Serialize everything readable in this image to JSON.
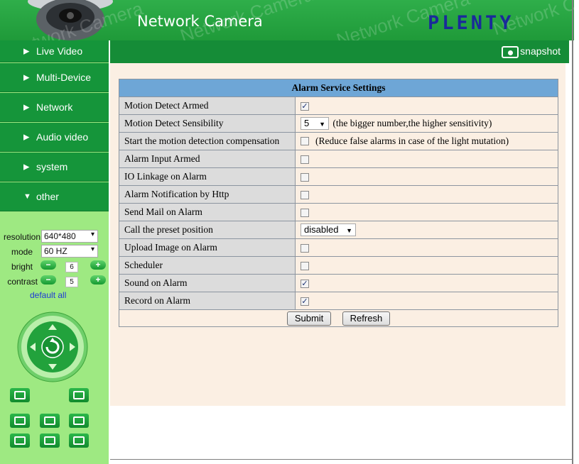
{
  "header": {
    "title": "Network Camera",
    "brand": "PLENTY",
    "watermark": "Network Camera"
  },
  "nav": [
    {
      "label": "Live Video",
      "icon": "play-arrow-icon"
    },
    {
      "label": "Multi-Device",
      "icon": "play-arrow-icon"
    },
    {
      "label": "Network",
      "icon": "play-arrow-icon"
    },
    {
      "label": "Audio video",
      "icon": "play-arrow-icon"
    },
    {
      "label": "system",
      "icon": "play-arrow-icon"
    },
    {
      "label": "other",
      "icon": "expanded-arrow-icon"
    }
  ],
  "controls": {
    "resolution_label": "resolution",
    "resolution_value": "640*480",
    "mode_label": "mode",
    "mode_value": "60 HZ",
    "bright_label": "bright",
    "bright_value": "6",
    "contrast_label": "contrast",
    "contrast_value": "5",
    "default_all": "default all"
  },
  "topbar": {
    "snapshot_label": "snapshot"
  },
  "settings": {
    "title": "Alarm Service Settings",
    "rows": [
      {
        "label": "Motion Detect Armed",
        "checked": true
      },
      {
        "label": "Motion Detect Sensibility",
        "select": "5",
        "note": "(the bigger number,the higher sensitivity)"
      },
      {
        "label": "Start the motion detection compensation",
        "checked": false,
        "note": "(Reduce false alarms in case of the light mutation)"
      },
      {
        "label": "Alarm Input Armed",
        "checked": false
      },
      {
        "label": "IO Linkage on Alarm",
        "checked": false
      },
      {
        "label": "Alarm Notification by Http",
        "checked": false
      },
      {
        "label": "Send Mail on Alarm",
        "checked": false
      },
      {
        "label": "Call the preset position",
        "select": "disabled"
      },
      {
        "label": "Upload Image on Alarm",
        "checked": false
      },
      {
        "label": "Scheduler",
        "checked": false
      },
      {
        "label": "Sound on Alarm",
        "checked": true
      },
      {
        "label": "Record on Alarm",
        "checked": true
      }
    ],
    "submit_label": "Submit",
    "refresh_label": "Refresh"
  },
  "colors": {
    "header_green": "#1f9a39",
    "nav_green": "#15953a",
    "sidebar_light": "#9ee982",
    "table_header_blue": "#6ea6d6",
    "content_bg": "#fbefe3",
    "brand_blue": "#1a2a9a"
  }
}
